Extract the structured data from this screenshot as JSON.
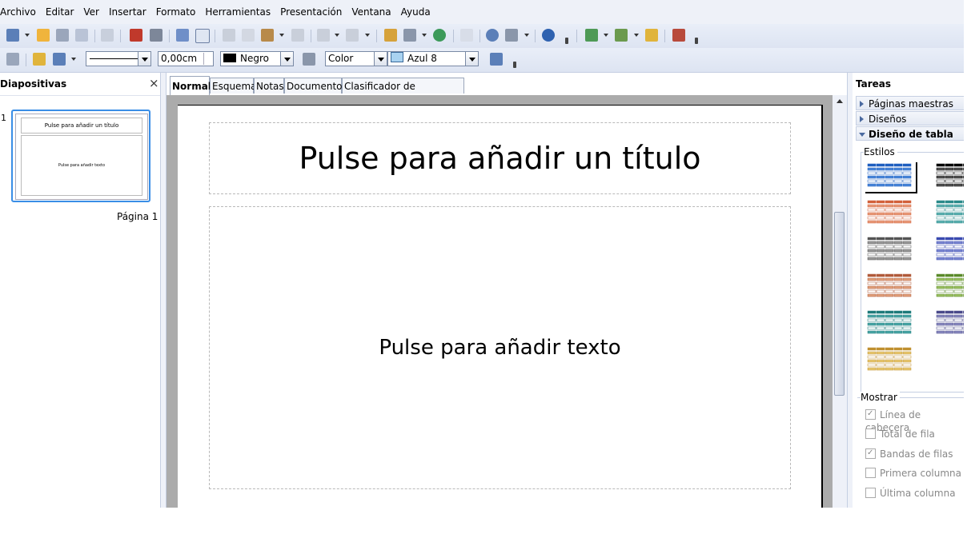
{
  "menu": [
    "Archivo",
    "Editar",
    "Ver",
    "Insertar",
    "Formato",
    "Herramientas",
    "Presentación",
    "Ventana",
    "Ayuda"
  ],
  "toolbar2": {
    "line_width": "0,00cm",
    "line_color": "Negro",
    "area_style": "Color",
    "area_color": "Azul 8"
  },
  "slides_panel": {
    "title": "Diapositivas",
    "close": "×",
    "slide_number": "1",
    "thumb_title": "Pulse para añadir un título",
    "thumb_body": "Pulse para añadir texto",
    "page_label": "Página 1"
  },
  "tabs": [
    "Normal",
    "Esquema",
    "Notas",
    "Documento",
    "Clasificador de diapositivas"
  ],
  "slide": {
    "title_placeholder": "Pulse para añadir un título",
    "body_placeholder": "Pulse para añadir texto"
  },
  "tasks": {
    "title": "Tareas",
    "sections": [
      "Páginas maestras",
      "Diseños",
      "Diseño de tabla"
    ],
    "styles_label": "Estilos",
    "show_label": "Mostrar",
    "options": [
      {
        "label": "Línea de cabecera",
        "checked": true
      },
      {
        "label": "Total de fila",
        "checked": false
      },
      {
        "label": "Bandas de filas",
        "checked": true
      },
      {
        "label": "Primera columna",
        "checked": false
      },
      {
        "label": "Última columna",
        "checked": false
      }
    ]
  },
  "colors": {
    "accent": "#3a8ee6",
    "toolbar_bg": "#e4eaf6",
    "workarea_bg": "#ababab"
  }
}
